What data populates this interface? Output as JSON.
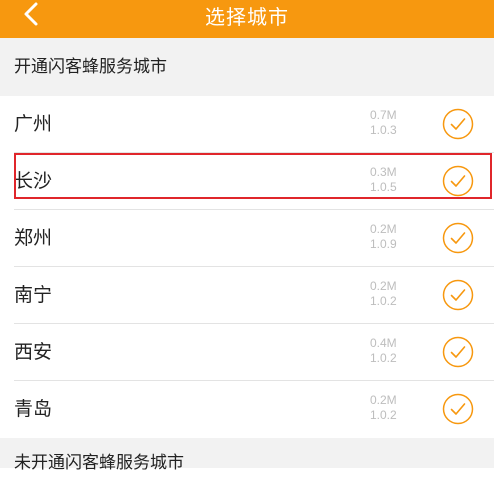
{
  "header": {
    "title": "选择城市"
  },
  "open_section": {
    "title": "开通闪客蜂服务城市"
  },
  "unopened_section": {
    "title": "未开通闪客蜂服务城市"
  },
  "cities": [
    {
      "name": "广州",
      "size": "0.7M",
      "version": "1.0.3"
    },
    {
      "name": "长沙",
      "size": "0.3M",
      "version": "1.0.5"
    },
    {
      "name": "郑州",
      "size": "0.2M",
      "version": "1.0.9"
    },
    {
      "name": "南宁",
      "size": "0.2M",
      "version": "1.0.2"
    },
    {
      "name": "西安",
      "size": "0.4M",
      "version": "1.0.2"
    },
    {
      "name": "青岛",
      "size": "0.2M",
      "version": "1.0.2"
    }
  ],
  "colors": {
    "accent": "#f7980f",
    "highlight": "#e0262b",
    "section_bg": "#f2f2f2"
  },
  "icons": {
    "back": "chevron-left-icon",
    "check": "check-circle-icon"
  }
}
